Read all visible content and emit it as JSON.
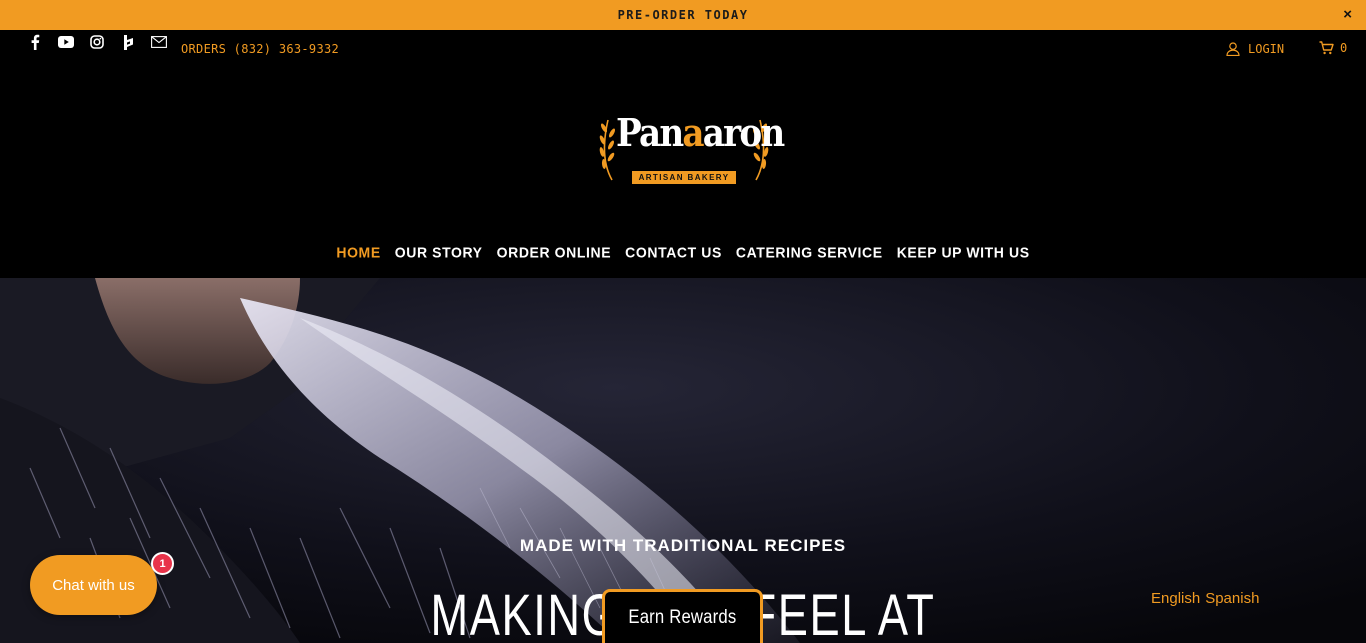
{
  "announcement": {
    "text": "PRE-ORDER TODAY",
    "close": "×"
  },
  "header": {
    "social_icons": [
      "facebook-icon",
      "youtube-icon",
      "instagram-icon",
      "houzz-icon",
      "mail-icon"
    ],
    "orders_text": "ORDERS (832) 363-9332",
    "login_label": "LOGIN",
    "cart_count": "0"
  },
  "logo": {
    "word_start": "Pan",
    "word_accent": "a",
    "word_end": "aron",
    "tagline": "ARTISAN BAKERY"
  },
  "nav": {
    "items": [
      {
        "label": "HOME",
        "active": true
      },
      {
        "label": "OUR STORY"
      },
      {
        "label": "ORDER ONLINE"
      },
      {
        "label": "CONTACT US"
      },
      {
        "label": "CATERING SERVICE"
      },
      {
        "label": "KEEP UP WITH US"
      }
    ]
  },
  "hero": {
    "subtitle": "MADE WITH TRADITIONAL RECIPES",
    "title": "MAKING YOU FEEL AT"
  },
  "chat": {
    "label": "Chat with us",
    "badge": "1"
  },
  "rewards": {
    "label": "Earn Rewards"
  },
  "language": {
    "options": [
      "English",
      "Spanish"
    ]
  },
  "colors": {
    "accent": "#f19b22",
    "background": "#000000",
    "badge": "#e8334a"
  }
}
